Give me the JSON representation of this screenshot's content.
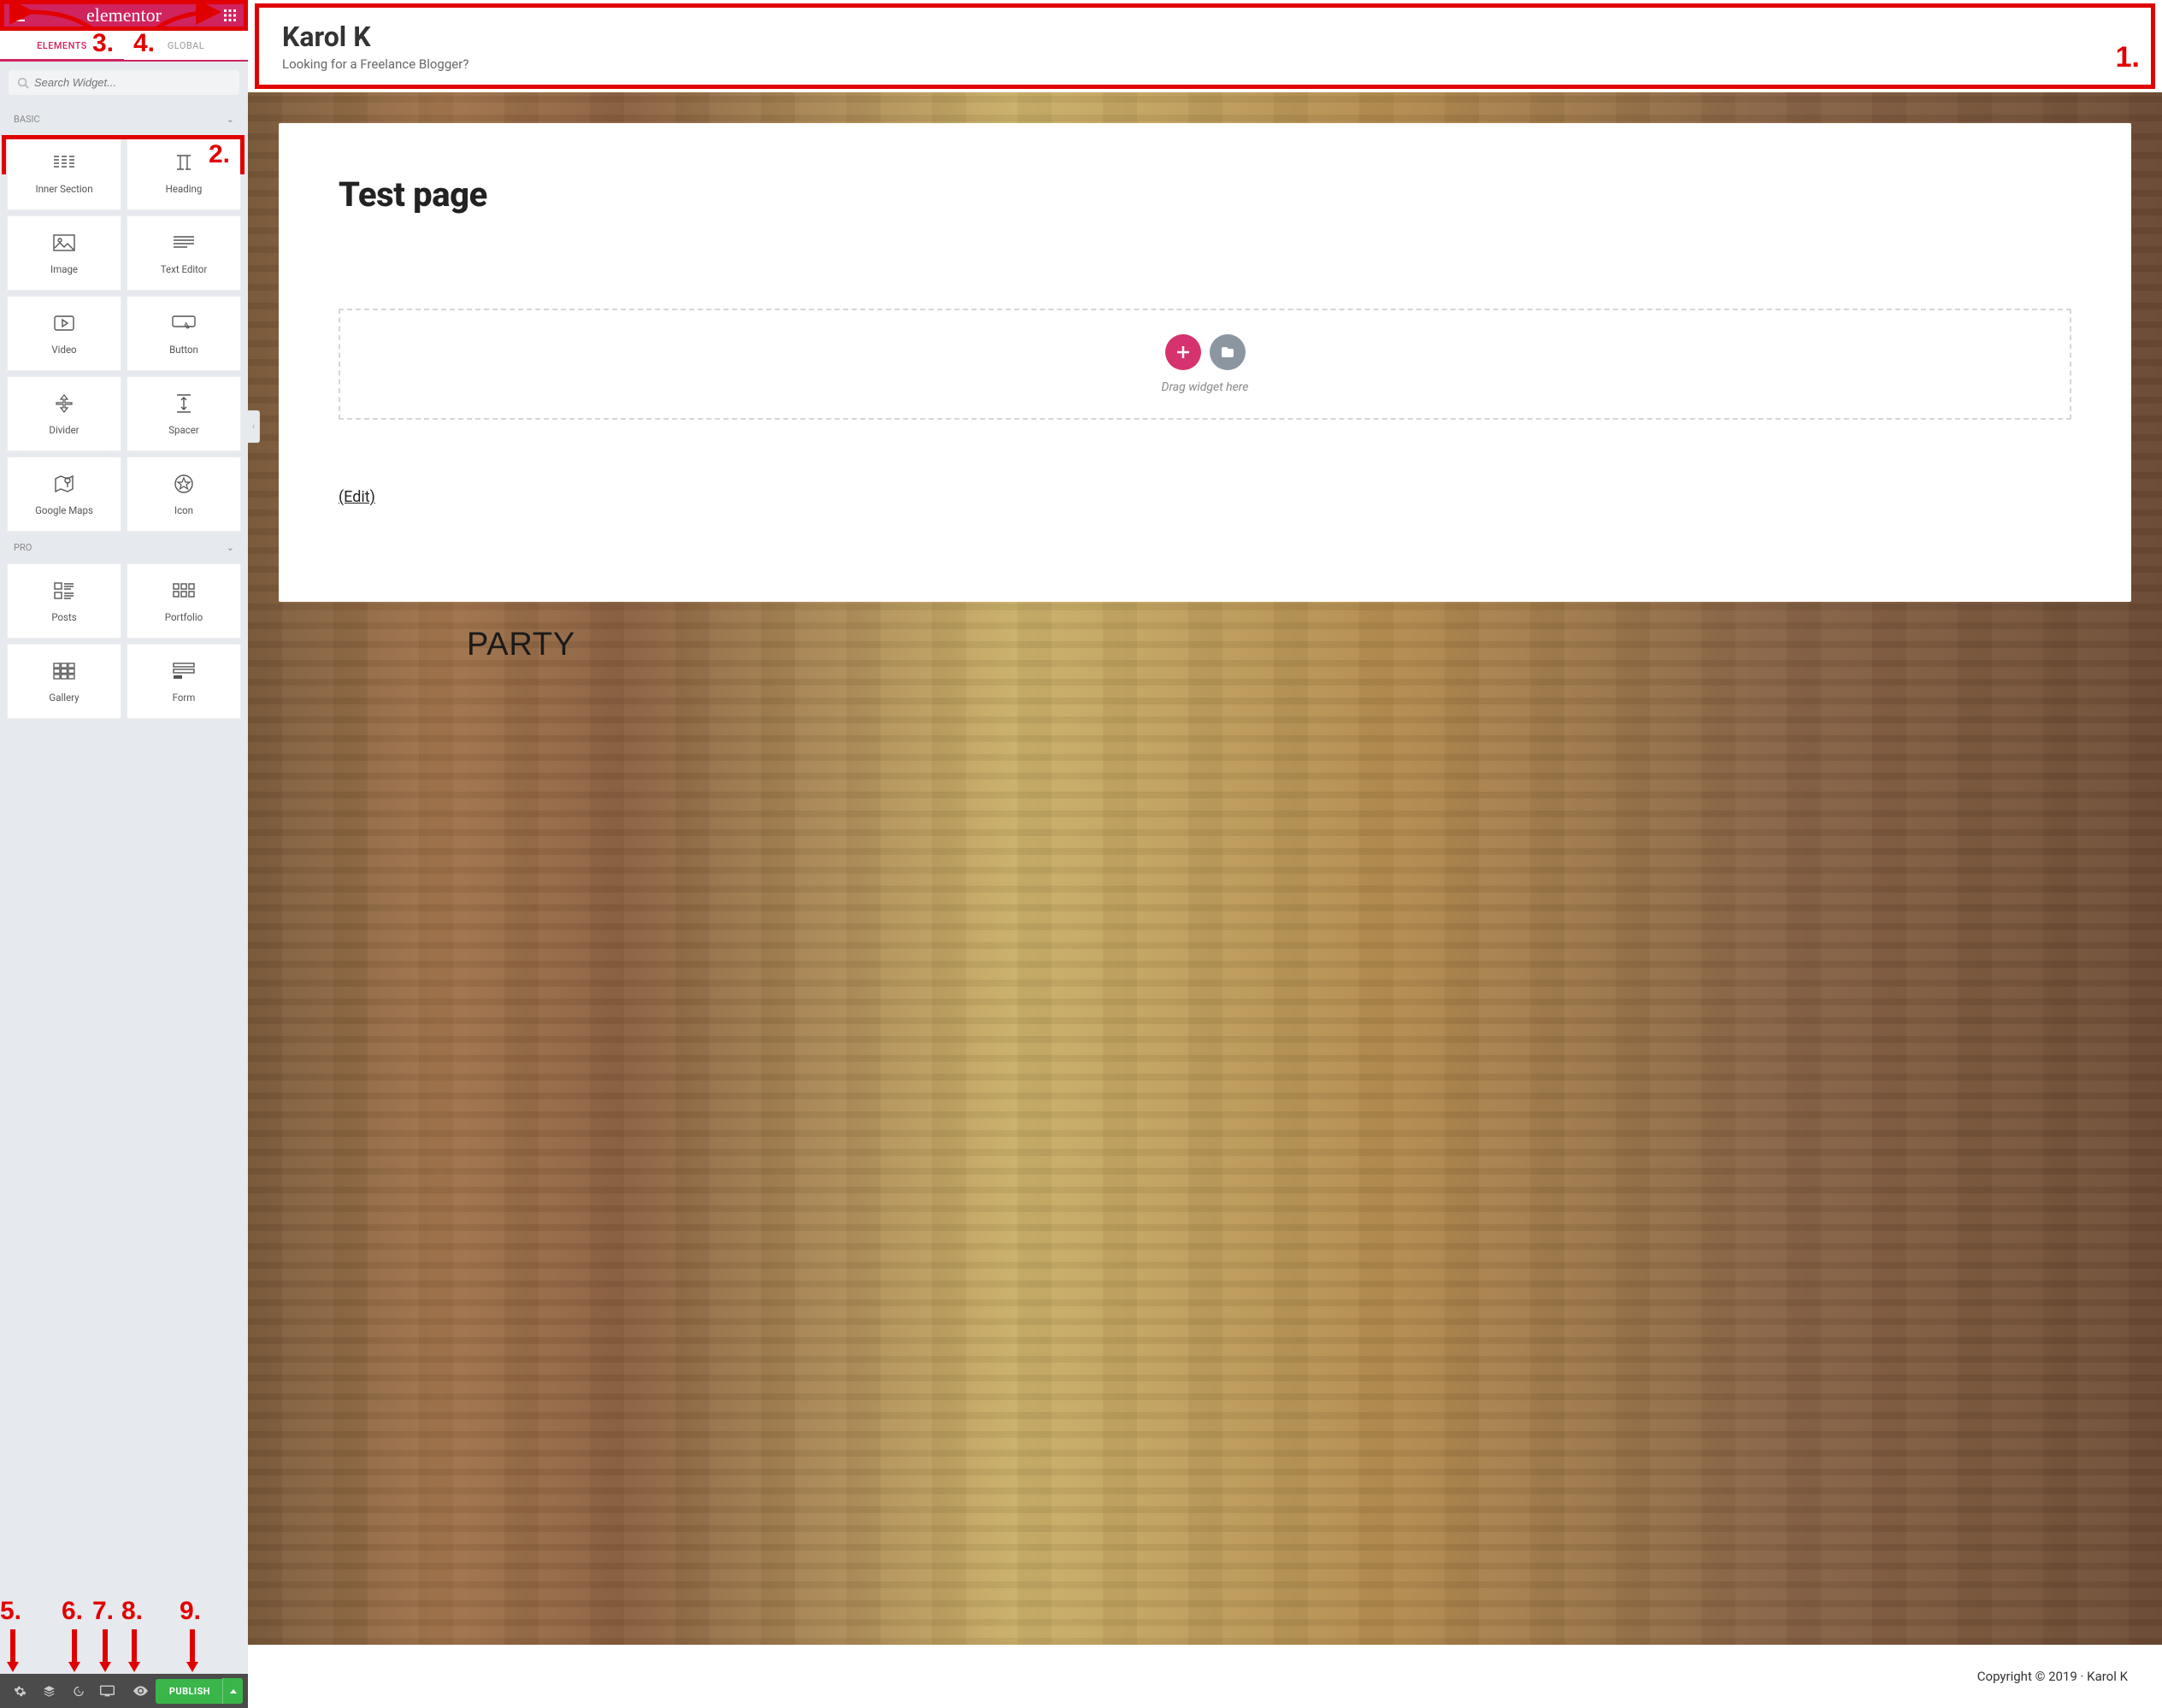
{
  "sidebar": {
    "brand": "elementor",
    "tabs": {
      "elements": "ELEMENTS",
      "global": "GLOBAL"
    },
    "search_placeholder": "Search Widget...",
    "cat_basic": "BASIC",
    "cat_pro": "PRO",
    "basic_widgets": [
      {
        "label": "Inner Section",
        "icon": "columns"
      },
      {
        "label": "Heading",
        "icon": "heading"
      },
      {
        "label": "Image",
        "icon": "image"
      },
      {
        "label": "Text Editor",
        "icon": "texteditor"
      },
      {
        "label": "Video",
        "icon": "video"
      },
      {
        "label": "Button",
        "icon": "button"
      },
      {
        "label": "Divider",
        "icon": "divider"
      },
      {
        "label": "Spacer",
        "icon": "spacer"
      },
      {
        "label": "Google Maps",
        "icon": "maps"
      },
      {
        "label": "Icon",
        "icon": "star"
      }
    ],
    "pro_widgets": [
      {
        "label": "Posts",
        "icon": "posts"
      },
      {
        "label": "Portfolio",
        "icon": "portfolio"
      },
      {
        "label": "Gallery",
        "icon": "gallery"
      },
      {
        "label": "Form",
        "icon": "form"
      }
    ],
    "publish": "PUBLISH"
  },
  "preview": {
    "site_title": "Karol K",
    "site_tagline": "Looking for a Freelance Blogger?",
    "page_title": "Test page",
    "drop_hint": "Drag widget here",
    "edit_label": "(Edit)",
    "party": "PARTY",
    "copyright": "Copyright © 2019 · Karol K"
  },
  "annotations": {
    "n1": "1.",
    "n2": "2.",
    "n3": "3.",
    "n4": "4.",
    "n5": "5.",
    "n6": "6.",
    "n7": "7.",
    "n8": "8.",
    "n9": "9."
  }
}
